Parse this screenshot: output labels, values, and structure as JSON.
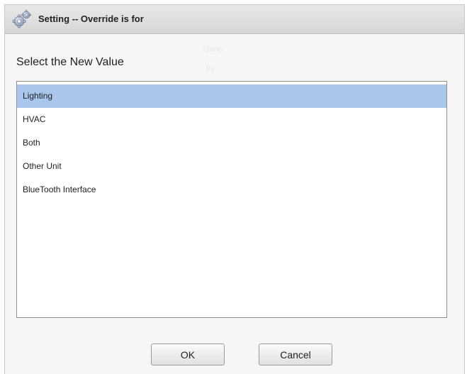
{
  "dialog": {
    "title": "Setting -- Override is for",
    "icon": "gears-icon",
    "prompt": "Select the New Value",
    "background_ghost_text": [
      "Gone",
      "By"
    ]
  },
  "list": {
    "selected_index": 0,
    "items": [
      {
        "label": "Lighting"
      },
      {
        "label": "HVAC"
      },
      {
        "label": "Both"
      },
      {
        "label": "Other Unit"
      },
      {
        "label": "BlueTooth Interface"
      }
    ]
  },
  "buttons": {
    "ok_label": "OK",
    "cancel_label": "Cancel"
  },
  "colors": {
    "selection": "#a9c6ed",
    "titlebar": "#dcdcdc"
  }
}
